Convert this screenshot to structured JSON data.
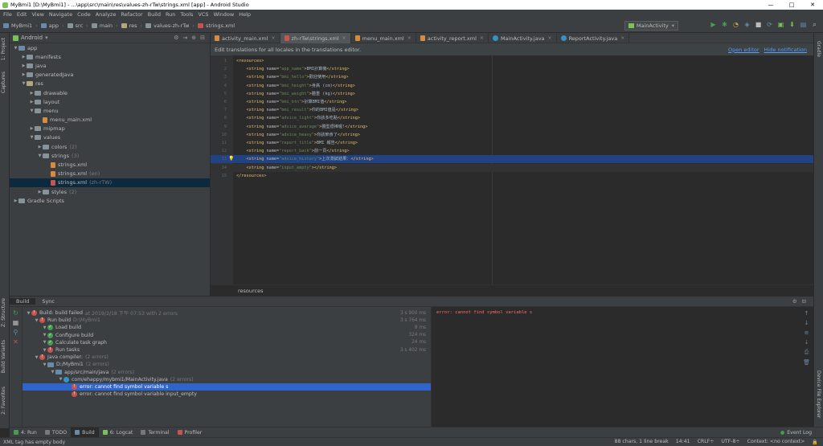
{
  "window": {
    "title": "MyBmi1 [D:\\MyBmi1] - ...\\app\\src\\main\\res\\values-zh-rTw\\strings.xml [app] - Android Studio",
    "min_glyph": "—",
    "max_glyph": "□",
    "close_glyph": "✕"
  },
  "menu": [
    "File",
    "Edit",
    "View",
    "Navigate",
    "Code",
    "Analyze",
    "Refactor",
    "Build",
    "Run",
    "Tools",
    "VCS",
    "Window",
    "Help"
  ],
  "breadcrumbs": [
    "MyBmi1",
    "app",
    "src",
    "main",
    "res",
    "values-zh-rTw",
    "strings.xml"
  ],
  "run_config": "MainActivity",
  "left_tabs": [
    "1: Project",
    "Captures",
    "Z: Structure",
    "Build Variants",
    "2: Favorites"
  ],
  "right_tabs": [
    "Gradle",
    "Device File Explorer"
  ],
  "project": {
    "view": "Android",
    "tree": [
      {
        "label": "app",
        "depth": 0,
        "icon": "folder-blue",
        "open": true
      },
      {
        "label": "manifests",
        "depth": 1,
        "icon": "folder",
        "open": false
      },
      {
        "label": "java",
        "depth": 1,
        "icon": "folder",
        "open": false
      },
      {
        "label": "generatedJava",
        "depth": 1,
        "icon": "folder",
        "open": false
      },
      {
        "label": "res",
        "depth": 1,
        "icon": "folder-res",
        "open": true
      },
      {
        "label": "drawable",
        "depth": 2,
        "icon": "folder",
        "open": false
      },
      {
        "label": "layout",
        "depth": 2,
        "icon": "folder",
        "open": false
      },
      {
        "label": "menu",
        "depth": 2,
        "icon": "folder",
        "open": true
      },
      {
        "label": "menu_main.xml",
        "depth": 3,
        "icon": "xml",
        "open": null
      },
      {
        "label": "mipmap",
        "depth": 2,
        "icon": "folder",
        "open": false
      },
      {
        "label": "values",
        "depth": 2,
        "icon": "folder",
        "open": true
      },
      {
        "label": "colors",
        "suffix": "(2)",
        "depth": 3,
        "icon": "folder",
        "open": false
      },
      {
        "label": "strings",
        "suffix": "(3)",
        "depth": 3,
        "icon": "folder",
        "open": true
      },
      {
        "label": "strings.xml",
        "depth": 4,
        "icon": "xml",
        "open": null
      },
      {
        "label": "strings.xml",
        "suffix": "(en)",
        "depth": 4,
        "icon": "xml",
        "open": null
      },
      {
        "label": "strings.xml",
        "suffix": "(zh-rTW)",
        "depth": 4,
        "icon": "xml-red",
        "open": null,
        "selected": true
      },
      {
        "label": "styles",
        "suffix": "(2)",
        "depth": 3,
        "icon": "folder",
        "open": false
      },
      {
        "label": "Gradle Scripts",
        "depth": 0,
        "icon": "gradle",
        "open": false
      }
    ]
  },
  "editor_tabs": [
    {
      "label": "activity_main.xml",
      "icon": "xml",
      "active": false
    },
    {
      "label": "zh-rTw\\strings.xml",
      "icon": "xml-red",
      "active": true
    },
    {
      "label": "menu_main.xml",
      "icon": "xml",
      "active": false
    },
    {
      "label": "activity_report.xml",
      "icon": "xml",
      "active": false
    },
    {
      "label": "MainActivity.java",
      "icon": "java",
      "active": false
    },
    {
      "label": "ReportActivity.java",
      "icon": "java",
      "active": false
    }
  ],
  "banner": {
    "text": "Edit translations for all locales in the translations editor.",
    "open_editor": "Open editor",
    "hide": "Hide notification"
  },
  "code_lines": [
    {
      "n": "1",
      "parts": [
        [
          "tag",
          "<resources>"
        ]
      ]
    },
    {
      "n": "2",
      "parts": [
        [
          "tag",
          "    <string "
        ],
        [
          "attr",
          "name="
        ],
        [
          "val",
          "\"app_name\""
        ],
        [
          "tag",
          ">"
        ],
        [
          "txt",
          "BMI計算機"
        ],
        [
          "tag",
          "</string>"
        ]
      ]
    },
    {
      "n": "3",
      "parts": [
        [
          "tag",
          "    <string "
        ],
        [
          "attr",
          "name="
        ],
        [
          "val",
          "\"bmi_hello\""
        ],
        [
          "tag",
          ">"
        ],
        [
          "txt",
          "歡迎使用"
        ],
        [
          "tag",
          "</string>"
        ]
      ]
    },
    {
      "n": "4",
      "parts": [
        [
          "tag",
          "    <string "
        ],
        [
          "attr",
          "name="
        ],
        [
          "val",
          "\"bmi_height\""
        ],
        [
          "tag",
          ">"
        ],
        [
          "txt",
          "身高 (cm)"
        ],
        [
          "tag",
          "</string>"
        ]
      ]
    },
    {
      "n": "5",
      "parts": [
        [
          "tag",
          "    <string "
        ],
        [
          "attr",
          "name="
        ],
        [
          "val",
          "\"bmi_weight\""
        ],
        [
          "tag",
          ">"
        ],
        [
          "txt",
          "體重 (kg)"
        ],
        [
          "tag",
          "</string>"
        ]
      ]
    },
    {
      "n": "6",
      "parts": [
        [
          "tag",
          "    <string "
        ],
        [
          "attr",
          "name="
        ],
        [
          "val",
          "\"bmi_btn\""
        ],
        [
          "tag",
          ">"
        ],
        [
          "txt",
          "計算BMI值"
        ],
        [
          "tag",
          "</string>"
        ]
      ]
    },
    {
      "n": "7",
      "parts": [
        [
          "tag",
          "    <string "
        ],
        [
          "attr",
          "name="
        ],
        [
          "val",
          "\"bmi_result\""
        ],
        [
          "tag",
          ">"
        ],
        [
          "txt",
          "你的BMI值是"
        ],
        [
          "tag",
          "</string>"
        ]
      ]
    },
    {
      "n": "8",
      "parts": [
        [
          "tag",
          "    <string "
        ],
        [
          "attr",
          "name="
        ],
        [
          "val",
          "\"advice_light\""
        ],
        [
          "tag",
          ">"
        ],
        [
          "txt",
          "你該多吃點"
        ],
        [
          "tag",
          "</string>"
        ]
      ]
    },
    {
      "n": "9",
      "parts": [
        [
          "tag",
          "    <string "
        ],
        [
          "attr",
          "name="
        ],
        [
          "val",
          "\"advice_average\""
        ],
        [
          "tag",
          ">"
        ],
        [
          "txt",
          "體型很棒喔!"
        ],
        [
          "tag",
          "</string>"
        ]
      ]
    },
    {
      "n": "10",
      "parts": [
        [
          "tag",
          "    <string "
        ],
        [
          "attr",
          "name="
        ],
        [
          "val",
          "\"advice_heavy\""
        ],
        [
          "tag",
          ">"
        ],
        [
          "txt",
          "你該節食了"
        ],
        [
          "tag",
          "</string>"
        ]
      ]
    },
    {
      "n": "11",
      "parts": [
        [
          "tag",
          "    <string "
        ],
        [
          "attr",
          "name="
        ],
        [
          "val",
          "\"report_title\""
        ],
        [
          "tag",
          ">"
        ],
        [
          "txt",
          "BMI 報告"
        ],
        [
          "tag",
          "</string>"
        ]
      ]
    },
    {
      "n": "12",
      "parts": [
        [
          "tag",
          "    <string "
        ],
        [
          "attr",
          "name="
        ],
        [
          "val",
          "\"report_back\""
        ],
        [
          "tag",
          ">"
        ],
        [
          "txt",
          "前一頁"
        ],
        [
          "tag",
          "</string>"
        ]
      ]
    },
    {
      "n": "13",
      "parts": [
        [
          "tag",
          "    <string "
        ],
        [
          "attr",
          "name="
        ],
        [
          "val",
          "\"advice_history\""
        ],
        [
          "tag",
          ">"
        ],
        [
          "txt",
          "上次測試結果："
        ],
        [
          "tag",
          "</string>"
        ]
      ],
      "hl": true
    },
    {
      "n": "14",
      "parts": [
        [
          "tag",
          "    <string "
        ],
        [
          "attr",
          "name="
        ],
        [
          "val",
          "\"input_empty\""
        ],
        [
          "tag",
          "></string>"
        ]
      ],
      "cur": true
    },
    {
      "n": "15",
      "parts": [
        [
          "tag",
          "</resources>"
        ]
      ]
    }
  ],
  "editor_footer": "resources",
  "build": {
    "tabs": [
      "Build",
      "Sync"
    ],
    "tree": [
      {
        "label": "Build: build failed",
        "extra": "at 2019/2/18 下午 07:53  with 2 errors",
        "depth": 0,
        "status": "err",
        "time": "3 s 900 ms"
      },
      {
        "label": "Run build",
        "extra": "D:\\MyBmi1",
        "depth": 1,
        "status": "err",
        "time": "3 s 764 ms"
      },
      {
        "label": "Load build",
        "extra": "",
        "depth": 2,
        "status": "ok",
        "time": "8 ms"
      },
      {
        "label": "Configure build",
        "extra": "",
        "depth": 2,
        "status": "ok",
        "time": "324 ms"
      },
      {
        "label": "Calculate task graph",
        "extra": "",
        "depth": 2,
        "status": "ok",
        "time": "24 ms"
      },
      {
        "label": "Run tasks",
        "extra": "",
        "depth": 2,
        "status": "err",
        "time": "3 s 402 ms"
      },
      {
        "label": "Java compiler:",
        "extra": "(2 errors)",
        "depth": 1,
        "status": "err",
        "time": ""
      },
      {
        "label": "D:/MyBmi1",
        "extra": "(2 errors)",
        "depth": 2,
        "status": "folder",
        "time": ""
      },
      {
        "label": "app/src/main/java",
        "extra": "(2 errors)",
        "depth": 3,
        "status": "folder",
        "time": ""
      },
      {
        "label": "com/ehappy/mybmi1/MainActivity.java",
        "extra": "(2 errors)",
        "depth": 4,
        "status": "java",
        "time": ""
      },
      {
        "label": "error: cannot find symbol variable s",
        "extra": "",
        "depth": 5,
        "status": "err",
        "time": "",
        "selected": true
      },
      {
        "label": "error: cannot find symbol variable input_empty",
        "extra": "",
        "depth": 5,
        "status": "err",
        "time": ""
      }
    ],
    "output": "error: cannot find symbol variable s"
  },
  "toolwindows": [
    {
      "label": "4: Run",
      "color": "#499c54"
    },
    {
      "label": "TODO",
      "color": "#787878"
    },
    {
      "label": "Build",
      "color": "#6a8ba8",
      "active": true
    },
    {
      "label": "6: Logcat",
      "color": "#78c257"
    },
    {
      "label": "Terminal",
      "color": "#787878"
    },
    {
      "label": "Profiler",
      "color": "#c75450"
    }
  ],
  "event_log": "Event Log",
  "status": {
    "message": "XML tag has empty body",
    "chars": "88 chars, 1 line break",
    "pos": "14:41",
    "crlf": "CRLF÷",
    "enc": "UTF-8÷",
    "ctx": "Context: <no context>"
  }
}
